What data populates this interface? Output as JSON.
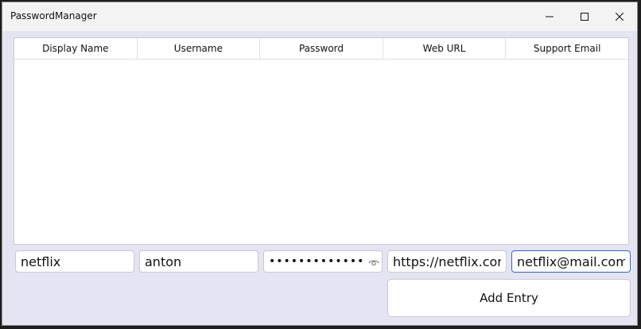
{
  "window": {
    "title": "PasswordManager"
  },
  "table": {
    "columns": [
      "Display Name",
      "Username",
      "Password",
      "Web URL",
      "Support Email"
    ],
    "rows": []
  },
  "form": {
    "display_name": "netflix",
    "username": "anton",
    "password": "••••••••••••••",
    "web_url": "https://netflix.com",
    "support_email": "netflix@mail.com",
    "add_button_label": "Add Entry"
  },
  "colors": {
    "background": "#e4e4f2",
    "field_border": "#c9c9d3",
    "focus_border": "#3366cc"
  }
}
